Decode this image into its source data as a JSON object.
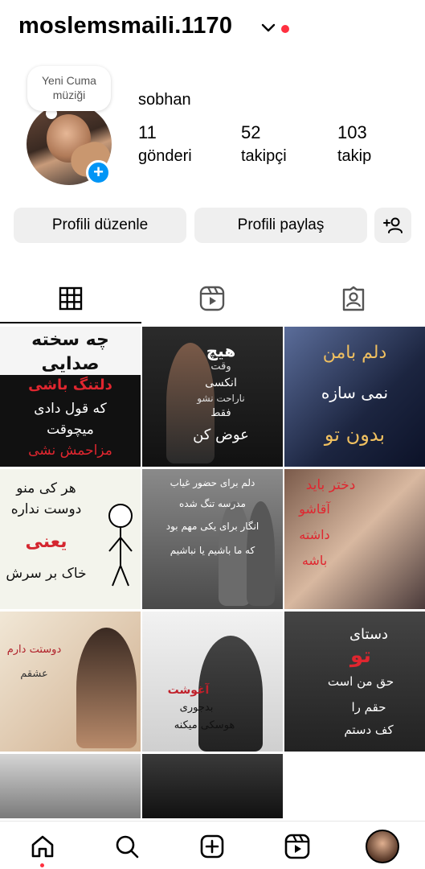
{
  "header": {
    "username": "moslemsmaili.1170",
    "notification_color": "#ff3040"
  },
  "profile": {
    "note_line1": "Yeni Cuma",
    "note_line2": "müziği",
    "display_name": "sobhan",
    "stats": [
      {
        "value": "11",
        "label": "gönderi"
      },
      {
        "value": "52",
        "label": "takipçi"
      },
      {
        "value": "103",
        "label": "takip"
      }
    ]
  },
  "actions": {
    "edit_label": "Profili düzenle",
    "share_label": "Profili paylaş"
  },
  "tabs": [
    {
      "icon": "grid-icon",
      "active": true
    },
    {
      "icon": "reels-icon",
      "active": false
    },
    {
      "icon": "tagged-icon",
      "active": false
    }
  ],
  "posts": [
    {
      "lines": [
        "چه سخته",
        "صدایی",
        "دلتنگ باشی",
        "که قول دادی",
        "میچوقت",
        "مزاحمش نشی"
      ]
    },
    {
      "lines": [
        "هیچ",
        "وقت",
        "انکسی",
        "ناراحت نشو",
        "فقط",
        "عوض کن"
      ]
    },
    {
      "lines": [
        "دلم بامن",
        "نمی سازه",
        "بدون تو"
      ]
    },
    {
      "lines": [
        "هر کی منو",
        "دوست نداره",
        "یعنی",
        "خاک بر سرش"
      ]
    },
    {
      "lines": [
        "دلم برای حضور غیاب",
        "مدرسه تنگ شده",
        "انگار برای یکی مهم بود",
        "که ما باشیم یا نباشیم"
      ]
    },
    {
      "lines": [
        "دختر باید",
        "آقاشو",
        "داشته",
        "باشه"
      ]
    },
    {
      "lines": [
        "دوستت دارم",
        "عشقم"
      ]
    },
    {
      "lines": [
        "آغوشت",
        "بدجوری",
        "هوسکی میکنه"
      ]
    },
    {
      "lines": [
        "دستای",
        "تو",
        "حق من است",
        "حقم را",
        "کف دستم"
      ]
    },
    {
      "lines": []
    },
    {
      "lines": []
    }
  ],
  "bottom_nav": [
    "home-icon",
    "search-icon",
    "create-icon",
    "reels-icon",
    "profile-avatar"
  ]
}
